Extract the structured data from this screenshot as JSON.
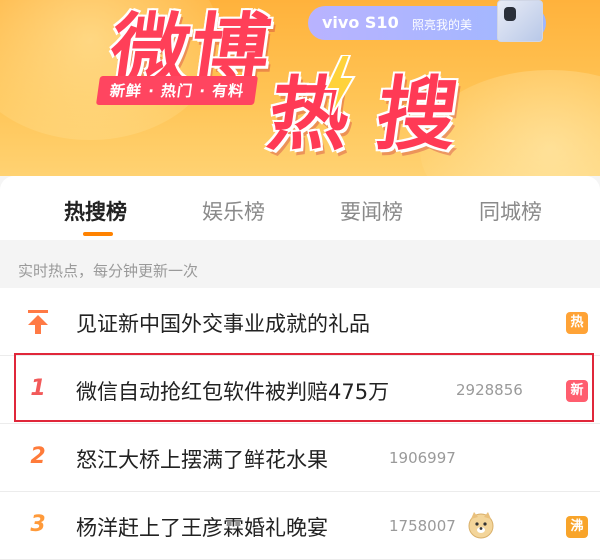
{
  "banner": {
    "logo_main": "微博",
    "logo_hot": "热搜",
    "tagline": "新鲜 · 热门 · 有料",
    "ad_brand": "vivo S10",
    "ad_slogan": "照亮我的美"
  },
  "tabs": [
    {
      "label": "热搜榜",
      "active": true
    },
    {
      "label": "娱乐榜",
      "active": false
    },
    {
      "label": "要闻榜",
      "active": false
    },
    {
      "label": "同城榜",
      "active": false
    }
  ],
  "subheader": {
    "text": "实时热点，每分钟更新一次"
  },
  "rows": [
    {
      "rank": "",
      "icon": "pin-top-icon",
      "title": "见证新中国外交事业成就的礼品",
      "count": "",
      "badge": "热",
      "badge_color": "#ffa336"
    },
    {
      "rank": "1",
      "title": "微信自动抢红包软件被判赔475万",
      "count": "2928856",
      "badge": "新",
      "badge_color": "#ff5e6f",
      "highlighted": true
    },
    {
      "rank": "2",
      "title": "怒江大桥上摆满了鲜花水果",
      "count": "1906997",
      "badge": ""
    },
    {
      "rank": "3",
      "title": "杨洋赶上了王彦霖婚礼晚宴",
      "count": "1758007",
      "emoji": "doge-emoji-icon",
      "badge": "沸",
      "badge_color": "#f8a42a"
    }
  ],
  "colors": {
    "accent": "#ff8200",
    "logo_red": "#ff3f58",
    "highlight_border": "#e0273a"
  }
}
